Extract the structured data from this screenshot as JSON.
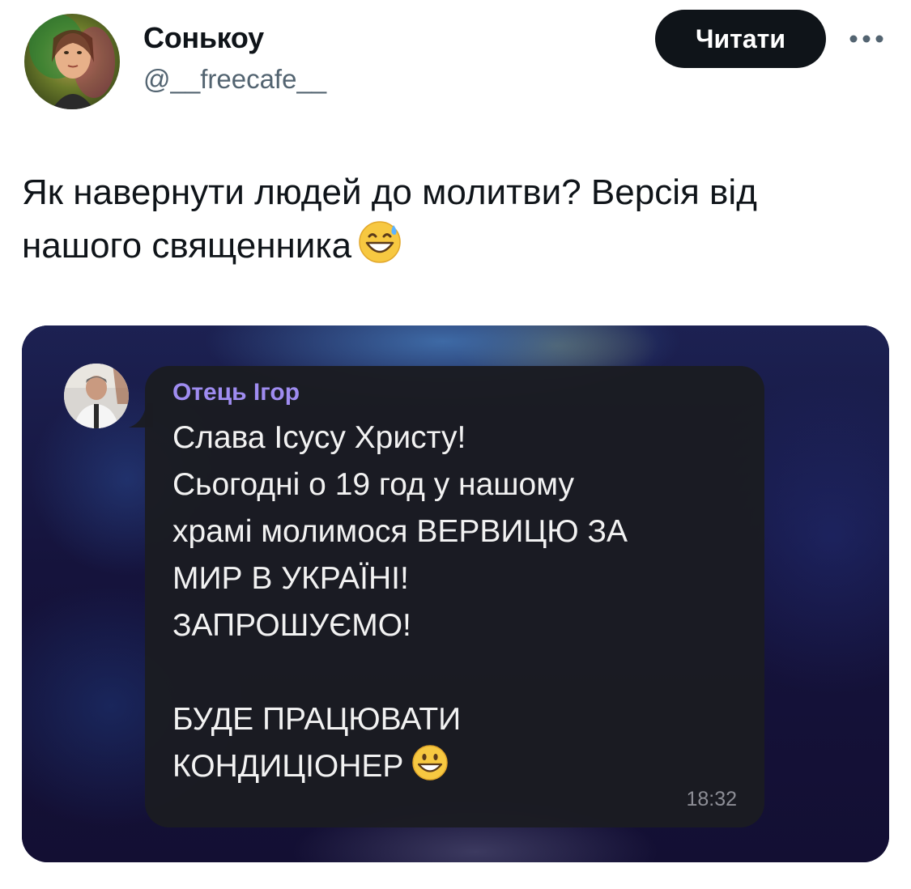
{
  "author": {
    "display_name": "Сонькоу",
    "handle": "@__freecafe__"
  },
  "follow_button_label": "Читати",
  "more_icon": "more-horizontal-icon",
  "tweet": {
    "lines": [
      "Як навернути людей до молитви? Версія від",
      "нашого священника"
    ],
    "emoji": "grinning-face-with-sweat-emoji"
  },
  "media": {
    "sender_name": "Отець Ігор",
    "message_lines": [
      "Слава Ісусу Христу!",
      "Сьогодні о 19 год у нашому",
      "храмі молимося ВЕРВИЦЮ ЗА",
      "МИР В УКРАЇНІ!",
      "ЗАПРОШУЄМО!",
      "",
      "БУДЕ ПРАЦЮВАТИ",
      "КОНДИЦІОНЕР"
    ],
    "message_emoji": "grinning-face-emoji",
    "timestamp": "18:32"
  },
  "colors": {
    "text_primary": "#0f1419",
    "text_secondary": "#536471",
    "button_bg": "#0f1419",
    "sender_name": "#9f8cf0",
    "bubble_bg": "#1b1c22"
  }
}
